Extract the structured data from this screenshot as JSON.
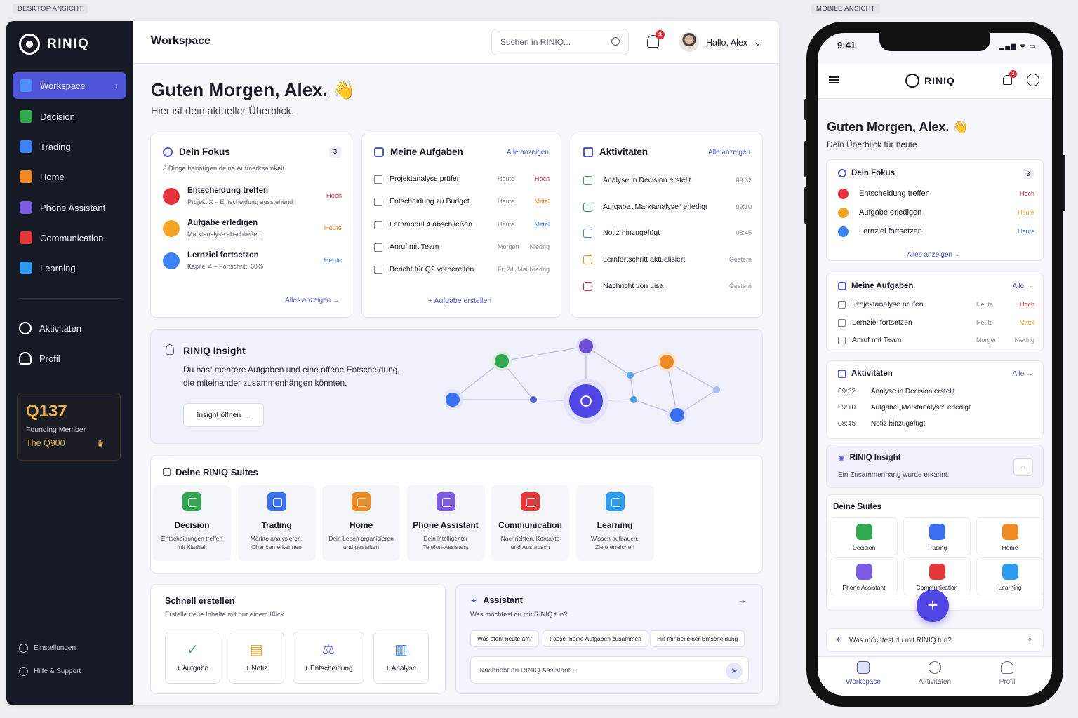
{
  "labels": {
    "desktop": "DESKTOP ANSICHT",
    "mobile": "MOBILE ANSICHT"
  },
  "brand": "RINIQ",
  "sidebar": {
    "items": [
      {
        "label": "Workspace",
        "color": "#4f8ff7"
      },
      {
        "label": "Decision",
        "color": "#2fa84f"
      },
      {
        "label": "Trading",
        "color": "#3b82f6"
      },
      {
        "label": "Home",
        "color": "#f08a24"
      },
      {
        "label": "Phone Assistant",
        "color": "#7c5ce6"
      },
      {
        "label": "Communication",
        "color": "#e5383b"
      },
      {
        "label": "Learning",
        "color": "#2b9cf2"
      }
    ],
    "secondary": [
      "Aktivitäten",
      "Profil"
    ],
    "member": {
      "code": "Q137",
      "title": "Founding Member",
      "tier": "The Q900",
      "crown": "♛"
    },
    "footer": [
      "Einstellungen",
      "Hilfe & Support"
    ]
  },
  "topbar": {
    "title": "Workspace",
    "search_placeholder": "Suchen in RINIQ...",
    "notif_count": "3",
    "greeting": "Hallo, Alex"
  },
  "hero": {
    "title": "Guten Morgen, Alex. 👋",
    "subtitle": "Hier ist dein aktueller Überblick."
  },
  "focus": {
    "title": "Dein Fokus",
    "count": "3",
    "subtitle": "3 Dinge benötigen deine Aufmerksamkeit",
    "items": [
      {
        "title": "Entscheidung treffen",
        "sub": "Projekt X – Entscheidung ausstehend",
        "prio": "Hoch",
        "prio_color": "#e5323a",
        "icon_color": "#e5323a"
      },
      {
        "title": "Aufgabe erledigen",
        "sub": "Marktanalyse abschließen",
        "prio": "Heute",
        "prio_color": "#f08a24",
        "icon_color": "#f5a524"
      },
      {
        "title": "Lernziel fortsetzen",
        "sub": "Kapitel 4 – Fortschritt: 60%",
        "prio": "Heute",
        "prio_color": "#3b82f6",
        "icon_color": "#3b82f6"
      }
    ],
    "link": "Alles anzeigen →"
  },
  "tasks": {
    "title": "Meine Aufgaben",
    "link": "Alle anzeigen",
    "items": [
      {
        "title": "Projektanalyse prüfen",
        "date": "Heute",
        "prio": "Hoch",
        "prio_color": "#e5323a"
      },
      {
        "title": "Entscheidung zu Budget",
        "date": "Heute",
        "prio": "Mittel",
        "prio_color": "#f08a24"
      },
      {
        "title": "Lernmodul 4 abschließen",
        "date": "Heute",
        "prio": "Mittel",
        "prio_color": "#3b82f6"
      },
      {
        "title": "Anruf mit Team",
        "date": "Morgen",
        "prio": "Niedrig",
        "prio_color": "#8a8f9c"
      },
      {
        "title": "Bericht für Q2 vorbereiten",
        "date": "Fr, 24. Mai",
        "prio": "Niedrig",
        "prio_color": "#8a8f9c"
      }
    ],
    "create": "+ Aufgabe erstellen"
  },
  "activities": {
    "title": "Aktivitäten",
    "link": "Alle anzeigen",
    "items": [
      {
        "title": "Analyse in Decision erstellt",
        "time": "09:32",
        "color": "#2fa84f"
      },
      {
        "title": "Aufgabe „Marktanalyse“ erledigt",
        "time": "09:10",
        "color": "#2fa84f"
      },
      {
        "title": "Notiz hinzugefügt",
        "time": "08:45",
        "color": "#3b82f6"
      },
      {
        "title": "Lernfortschritt aktualisiert",
        "time": "Gestern",
        "color": "#f08a24"
      },
      {
        "title": "Nachricht von Lisa",
        "time": "Gestern",
        "color": "#e5323a"
      }
    ]
  },
  "insight": {
    "title": "RINIQ Insight",
    "text1": "Du hast mehrere Aufgaben und eine offene Entscheidung,",
    "text2": "die miteinander zusammenhängen könnten.",
    "button": "Insight öffnen →"
  },
  "suites": {
    "title": "Deine RINIQ Suites",
    "items": [
      {
        "name": "Decision",
        "d1": "Entscheidungen treffen",
        "d2": "mit Klarheit",
        "color": "#2fa84f"
      },
      {
        "name": "Trading",
        "d1": "Märkte analysieren,",
        "d2": "Chancen erkennen",
        "color": "#3b6ff2"
      },
      {
        "name": "Home",
        "d1": "Dein Leben organisieren",
        "d2": "und gestalten",
        "color": "#f08a24"
      },
      {
        "name": "Phone Assistant",
        "d1": "Dein intelligenter",
        "d2": "Telefon-Assistent",
        "color": "#7c5ce6"
      },
      {
        "name": "Communication",
        "d1": "Nachrichten, Kontakte",
        "d2": "und Austausch",
        "color": "#e5383b"
      },
      {
        "name": "Learning",
        "d1": "Wissen aufbauen,",
        "d2": "Ziele erreichen",
        "color": "#2b9cf2"
      }
    ]
  },
  "quick": {
    "title": "Schnell erstellen",
    "subtitle": "Erstelle neue Inhalte mit nur einem Klick.",
    "items": [
      {
        "label": "+ Aufgabe",
        "icon": "✓",
        "color": "#2fa84f"
      },
      {
        "label": "+ Notiz",
        "icon": "▤",
        "color": "#f5a524"
      },
      {
        "label": "+ Entscheidung",
        "icon": "⚖",
        "color": "#4f56d9"
      },
      {
        "label": "+ Analyse",
        "icon": "▥",
        "color": "#3b82f6"
      }
    ]
  },
  "assistant": {
    "title": "Assistant",
    "subtitle": "Was möchtest du mit RINIQ tun?",
    "arrow": "→",
    "chips": [
      "Was steht heute an?",
      "Fasse meine Aufgaben zusammen",
      "Hilf mir bei einer Entscheidung"
    ],
    "placeholder": "Nachricht an RINIQ Assistant..."
  },
  "mobile": {
    "time": "9:41",
    "status": "▂▄▆ ᯤ ▭",
    "notif": "3",
    "greet": "Guten Morgen, Alex. 👋",
    "sub": "Dein Überblick für heute.",
    "focus": {
      "title": "Dein Fokus",
      "count": "3",
      "items": [
        {
          "t": "Entscheidung treffen",
          "p": "Hoch",
          "c": "#e5323a"
        },
        {
          "t": "Aufgabe erledigen",
          "p": "Heute",
          "c": "#f5a524"
        },
        {
          "t": "Lernziel fortsetzen",
          "p": "Heute",
          "c": "#3b82f6"
        }
      ],
      "link": "Alles anzeigen →"
    },
    "tasks": {
      "title": "Meine Aufgaben",
      "link": "Alle →",
      "items": [
        {
          "t": "Projektanalyse prüfen",
          "d": "Heute",
          "p": "Hoch",
          "c": "#e5323a"
        },
        {
          "t": "Lernziel fortsetzen",
          "d": "Heute",
          "p": "Mittel",
          "c": "#f5a524"
        },
        {
          "t": "Anruf mit Team",
          "d": "Morgen",
          "p": "Niedrig",
          "c": "#8a8f9c"
        }
      ]
    },
    "acts": {
      "title": "Aktivitäten",
      "link": "Alle →",
      "items": [
        {
          "tm": "09:32",
          "t": "Analyse in Decision erstellt"
        },
        {
          "tm": "09:10",
          "t": "Aufgabe „Marktanalyse“ erledigt"
        },
        {
          "tm": "08:45",
          "t": "Notiz hinzugefügt"
        }
      ]
    },
    "insight": {
      "title": "RINIQ Insight",
      "text": "Ein Zusammenhang wurde erkannt.",
      "arrow": "→"
    },
    "suites": {
      "title": "Deine Suites",
      "items": [
        "Decision",
        "Trading",
        "Home",
        "Phone Assistant",
        "Communication",
        "Learning"
      ]
    },
    "fab": "+",
    "ask": "Was möchtest du mit RINIQ tun?",
    "tabs": [
      "Workspace",
      "Aktivitäten",
      "Profil"
    ]
  }
}
